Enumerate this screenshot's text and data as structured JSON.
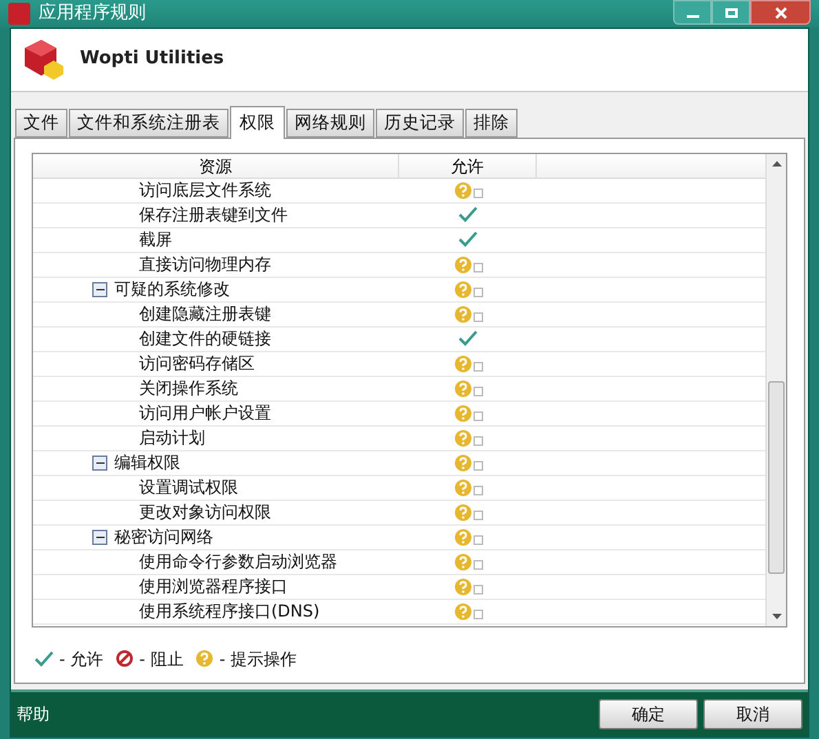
{
  "window": {
    "title": "应用程序规则"
  },
  "app": {
    "name": "Wopti Utilities"
  },
  "tabs": [
    {
      "label": "文件",
      "selected": false
    },
    {
      "label": "文件和系统注册表",
      "selected": false
    },
    {
      "label": "权限",
      "selected": true
    },
    {
      "label": "网络规则",
      "selected": false
    },
    {
      "label": "历史记录",
      "selected": false
    },
    {
      "label": "排除",
      "selected": false
    }
  ],
  "table": {
    "columns": [
      "资源",
      "允许"
    ],
    "rows": [
      {
        "name": "访问底层文件系统",
        "kind": "ask"
      },
      {
        "name": "保存注册表键到文件",
        "kind": "allow"
      },
      {
        "name": "截屏",
        "kind": "allow"
      },
      {
        "name": "直接访问物理内存",
        "kind": "ask"
      },
      {
        "name": "可疑的系统修改",
        "kind": "ask",
        "expanded": true,
        "children": [
          {
            "name": "创建隐藏注册表键",
            "kind": "ask"
          },
          {
            "name": "创建文件的硬链接",
            "kind": "allow"
          },
          {
            "name": "访问密码存储区",
            "kind": "ask"
          },
          {
            "name": "关闭操作系统",
            "kind": "ask"
          },
          {
            "name": "访问用户帐户设置",
            "kind": "ask"
          },
          {
            "name": "启动计划",
            "kind": "ask"
          }
        ]
      },
      {
        "name": "编辑权限",
        "kind": "ask",
        "expanded": true,
        "children": [
          {
            "name": "设置调试权限",
            "kind": "ask"
          },
          {
            "name": "更改对象访问权限",
            "kind": "ask"
          }
        ]
      },
      {
        "name": "秘密访问网络",
        "kind": "ask",
        "expanded": true,
        "children": [
          {
            "name": "使用命令行参数启动浏览器",
            "kind": "ask"
          },
          {
            "name": "使用浏览器程序接口",
            "kind": "ask"
          },
          {
            "name": "使用系统程序接口(DNS)",
            "kind": "ask"
          }
        ]
      }
    ]
  },
  "legend": [
    {
      "kind": "allow",
      "label": "- 允许"
    },
    {
      "kind": "block",
      "label": "- 阻止"
    },
    {
      "kind": "ask",
      "label": "- 提示操作"
    }
  ],
  "footer": {
    "help": "帮助",
    "buttons": [
      "确定",
      "取消"
    ]
  }
}
